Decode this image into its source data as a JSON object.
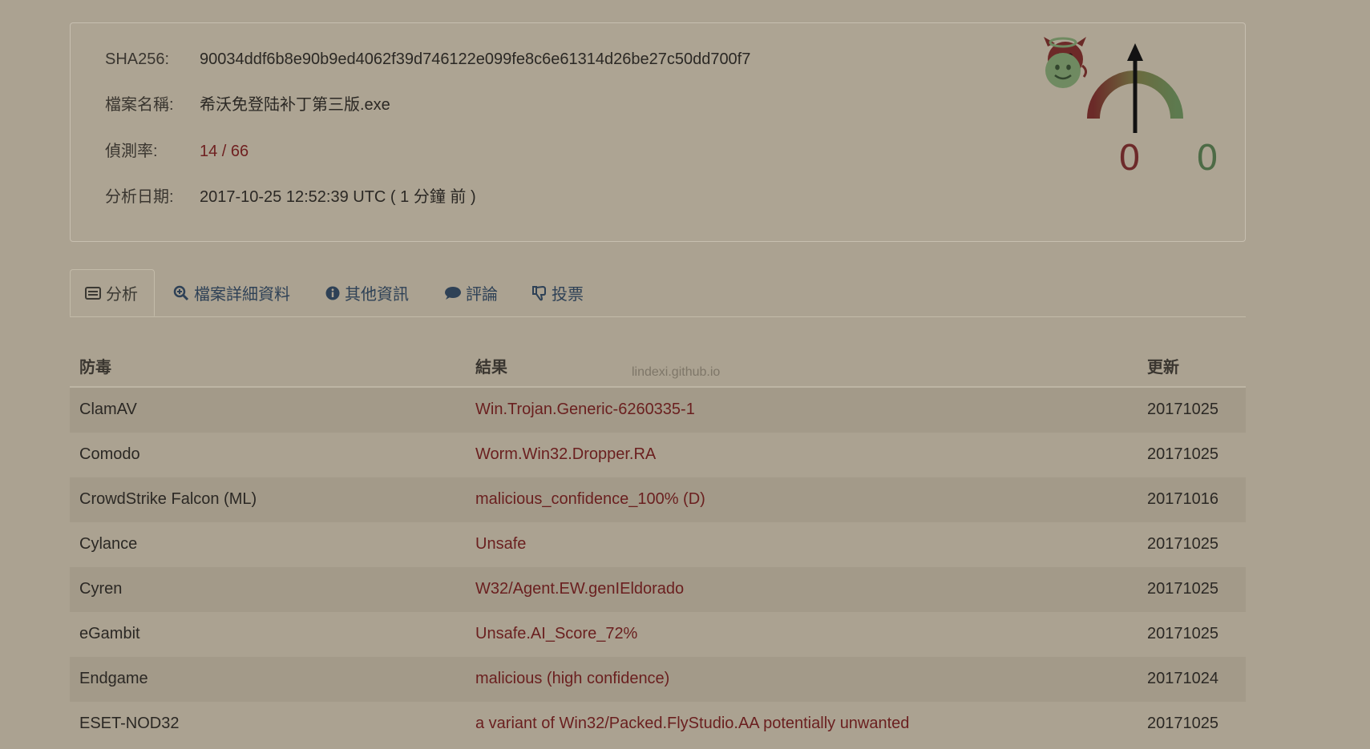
{
  "summary": {
    "sha256_label": "SHA256:",
    "sha256_value": "90034ddf6b8e90b9ed4062f39d746122e099fe8c6e61314d26be27c50dd700f7",
    "filename_label": "檔案名稱:",
    "filename_value": "希沃免登陆补丁第三版.exe",
    "detection_label": "偵測率:",
    "detection_value": "14 / 66",
    "date_label": "分析日期:",
    "date_value": "2017-10-25 12:52:39 UTC ( 1 分鐘 前 )"
  },
  "votes": {
    "malicious_count": "0",
    "harmless_count": "0",
    "malicious_icon": "devil-face-icon",
    "harmless_icon": "angel-face-icon",
    "gauge_icon": "score-gauge-icon"
  },
  "tabs": [
    {
      "label": "分析",
      "icon": "list-icon",
      "active": true
    },
    {
      "label": "檔案詳細資料",
      "icon": "magnifier-icon",
      "active": false
    },
    {
      "label": "其他資訊",
      "icon": "info-icon",
      "active": false
    },
    {
      "label": "評論",
      "icon": "comment-icon",
      "active": false
    },
    {
      "label": "投票",
      "icon": "thumbs-down-icon",
      "active": false
    }
  ],
  "table": {
    "headers": [
      "防毒",
      "結果",
      "更新"
    ],
    "rows": [
      [
        "ClamAV",
        "Win.Trojan.Generic-6260335-1",
        "20171025"
      ],
      [
        "Comodo",
        "Worm.Win32.Dropper.RA",
        "20171025"
      ],
      [
        "CrowdStrike Falcon (ML)",
        "malicious_confidence_100% (D)",
        "20171016"
      ],
      [
        "Cylance",
        "Unsafe",
        "20171025"
      ],
      [
        "Cyren",
        "W32/Agent.EW.genIEldorado",
        "20171025"
      ],
      [
        "eGambit",
        "Unsafe.AI_Score_72%",
        "20171025"
      ],
      [
        "Endgame",
        "malicious (high confidence)",
        "20171024"
      ],
      [
        "ESET-NOD32",
        "a variant of Win32/Packed.FlyStudio.AA potentially unwanted",
        "20171025"
      ]
    ]
  },
  "watermark": "lindexi.github.io",
  "colors": {
    "background": "#aba291",
    "malicious": "#6a1f1f",
    "harmless": "#4d6b46",
    "tab_link": "#2e4156"
  }
}
